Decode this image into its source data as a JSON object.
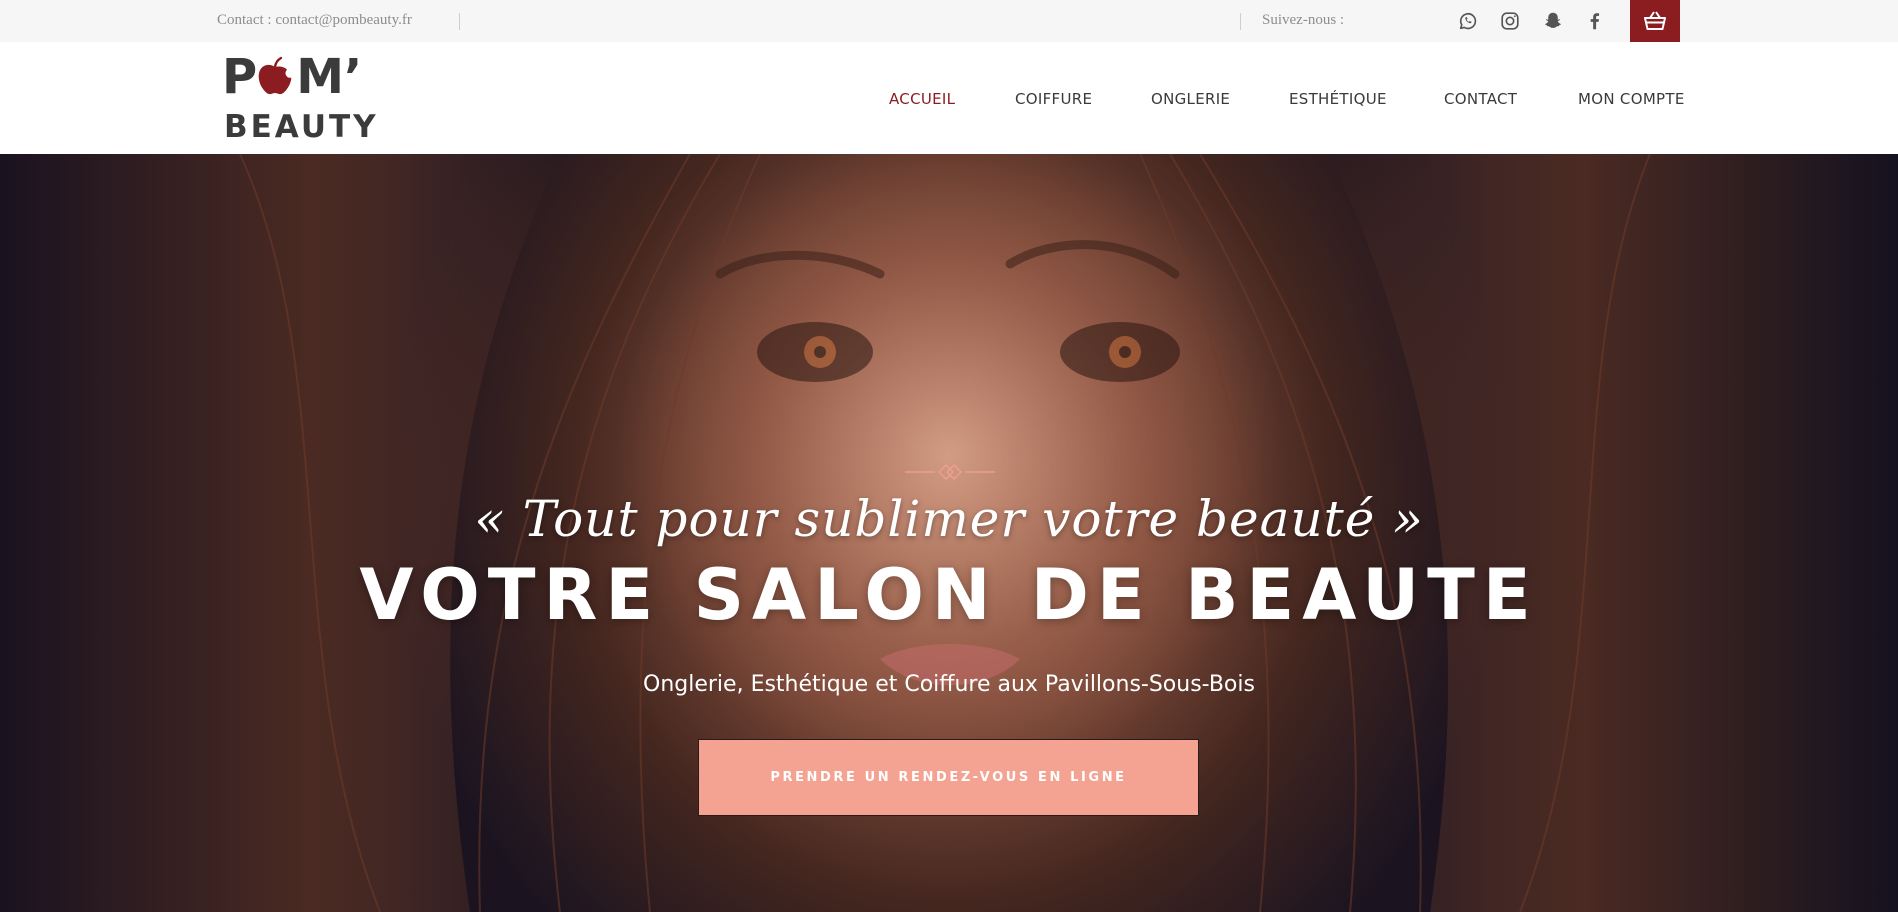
{
  "topbar": {
    "contact_text": "Contact : contact@pombeauty.fr",
    "follow_text": "Suivez-nous :",
    "social_icons": [
      "whatsapp-icon",
      "instagram-icon",
      "snapchat-icon",
      "facebook-icon"
    ],
    "cart_icon": "basket-icon"
  },
  "header": {
    "logo": {
      "top_left": "P",
      "top_right": "M’",
      "bottom": "BEAUTY",
      "apple_icon": "apple-icon"
    },
    "nav": [
      {
        "label": "ACCUEIL",
        "active": true
      },
      {
        "label": "COIFFURE",
        "active": false
      },
      {
        "label": "ONGLERIE",
        "active": false
      },
      {
        "label": "ESTHÉTIQUE",
        "active": false
      },
      {
        "label": "CONTACT",
        "active": false
      },
      {
        "label": "MON COMPTE",
        "active": false
      }
    ]
  },
  "hero": {
    "tagline": "« Tout pour sublimer votre beauté »",
    "title": "VOTRE SALON DE BEAUTE",
    "subtitle": "Onglerie, Esthétique et Coiffure aux Pavillons-Sous-Bois",
    "cta_label": "PRENDRE UN RENDEZ-VOUS EN LIGNE"
  },
  "colors": {
    "brand": "#8b1c1f",
    "cta": "#f4a292",
    "topbar_bg": "#f6f6f6",
    "nav_text": "#3a3a3a",
    "muted_text": "#8d8d8d"
  }
}
